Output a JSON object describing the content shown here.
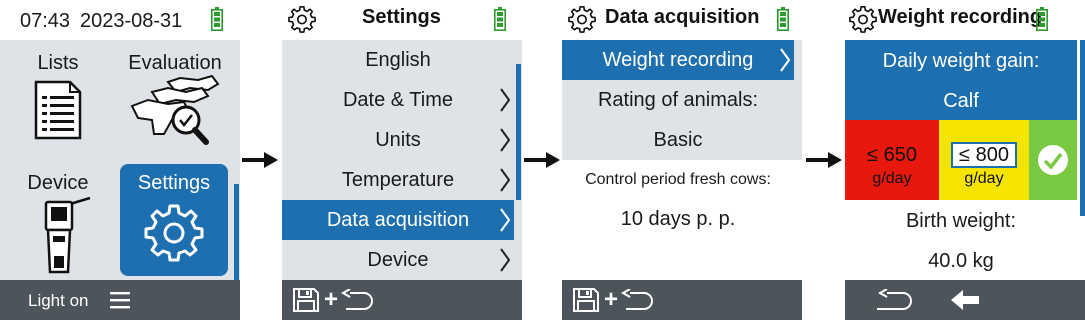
{
  "screen1": {
    "time": "07:43",
    "date": "2023-08-31",
    "tiles": [
      {
        "label": "Lists",
        "icon": "list-document-icon"
      },
      {
        "label": "Evaluation",
        "icon": "cows-magnifier-icon"
      },
      {
        "label": "Device",
        "icon": "handheld-device-icon"
      },
      {
        "label": "Settings",
        "icon": "gear-icon",
        "selected": true
      }
    ],
    "footer": {
      "light_label": "Light on",
      "menu_icon": "hamburger-menu-icon"
    }
  },
  "screen2": {
    "title": "Settings",
    "items": [
      {
        "label": "English",
        "chevron": false
      },
      {
        "label": "Date & Time",
        "chevron": true
      },
      {
        "label": "Units",
        "chevron": true
      },
      {
        "label": "Temperature",
        "chevron": true
      },
      {
        "label": "Data acquisition",
        "chevron": true,
        "selected": true
      },
      {
        "label": "Device",
        "chevron": true
      }
    ],
    "footer": {
      "plus": "+"
    }
  },
  "screen3": {
    "title": "Data acquisition",
    "selected_item": "Weight recording",
    "rating_label": "Rating of animals:",
    "rating_value": "Basic",
    "control_label": "Control period fresh cows:",
    "control_value": "10 days p. p.",
    "footer": {
      "plus": "+"
    }
  },
  "screen4": {
    "title": "Weight recording",
    "gain_label": "Daily weight gain:",
    "gain_category": "Calf",
    "thresholds": [
      {
        "value": "≤ 650",
        "unit": "g/day",
        "color": "#e8180f"
      },
      {
        "value": "≤ 800",
        "unit": "g/day",
        "color": "#f5e400"
      }
    ],
    "ok_color": "#7ac943",
    "birth_label": "Birth weight:",
    "birth_value": "40.0 kg"
  },
  "colors": {
    "accent": "#1d6fb0",
    "footer": "#4e545c",
    "panel": "#dfe3e8",
    "battery": "#2e9b2e"
  }
}
